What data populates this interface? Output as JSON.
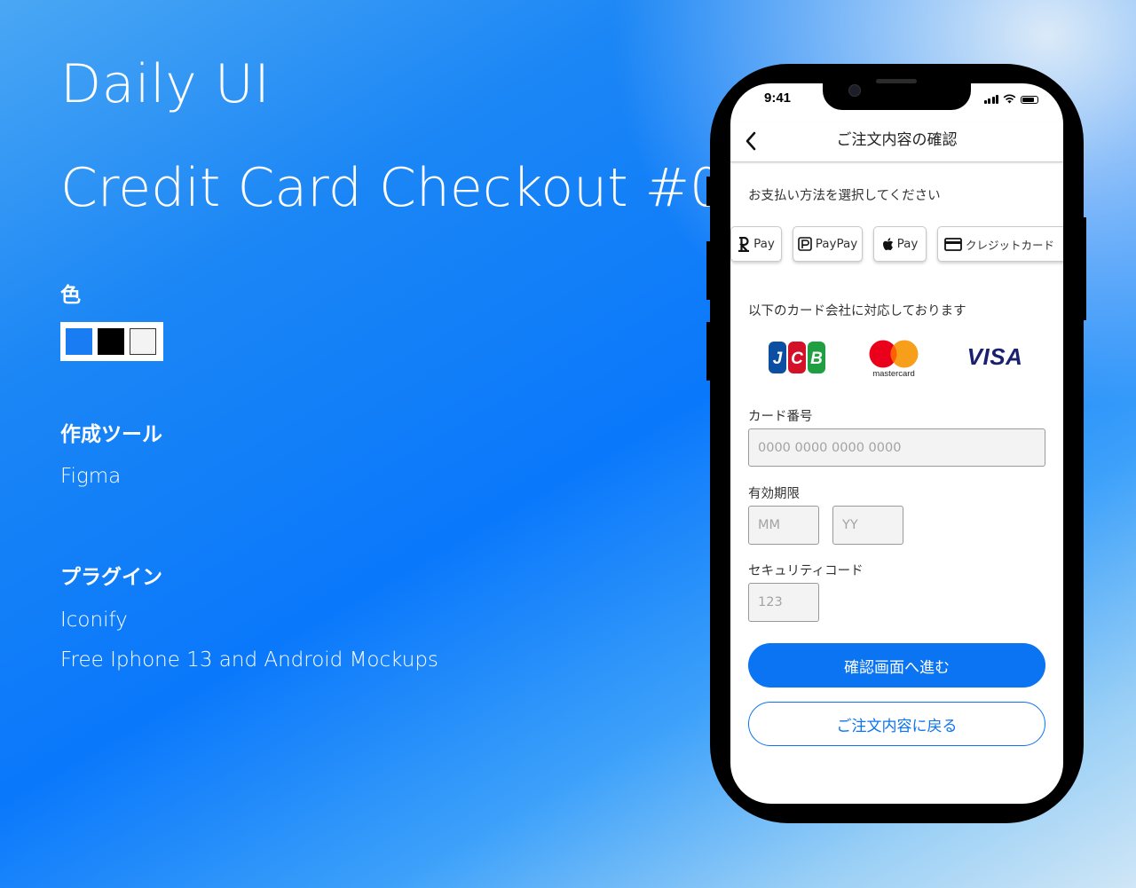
{
  "left": {
    "title": "Daily UI",
    "subtitle": "Credit Card Checkout #002",
    "color_heading": "色",
    "colors": [
      "#1a7cf2",
      "#000000",
      "#f3f3f3"
    ],
    "tool_heading": "作成ツール",
    "tool": "Figma",
    "plugin_heading": "プラグイン",
    "plugins": [
      "Iconify",
      "Free Iphone 13 and Android Mockups"
    ]
  },
  "phone": {
    "status_time": "9:41",
    "header": {
      "back_icon": "chevron-left-icon",
      "title": "ご注文内容の確認"
    },
    "payment_prompt": "お支払い方法を選択してください",
    "payment_methods": [
      {
        "icon": "rakuten-r-icon",
        "label": "Pay"
      },
      {
        "icon": "paypay-icon",
        "label": "PayPay"
      },
      {
        "icon": "apple-icon",
        "label": "Pay"
      },
      {
        "icon": "credit-card-icon",
        "label": "クレジットカード"
      }
    ],
    "supported_cards_label": "以下のカード会社に対応しております",
    "card_brands": [
      {
        "name": "JCB",
        "logo_text": "JCB"
      },
      {
        "name": "mastercard",
        "logo_text": "mastercard"
      },
      {
        "name": "VISA",
        "logo_text": "VISA"
      }
    ],
    "card_number": {
      "label": "カード番号",
      "placeholder": "0000 0000 0000 0000"
    },
    "expiry": {
      "label": "有効期限",
      "month_placeholder": "MM",
      "year_placeholder": "YY"
    },
    "security_code": {
      "label": "セキュリティコード",
      "placeholder": "123"
    },
    "primary_button": "確認画面へ進む",
    "secondary_button": "ご注文内容に戻る",
    "accent_color": "#0a74f2"
  }
}
